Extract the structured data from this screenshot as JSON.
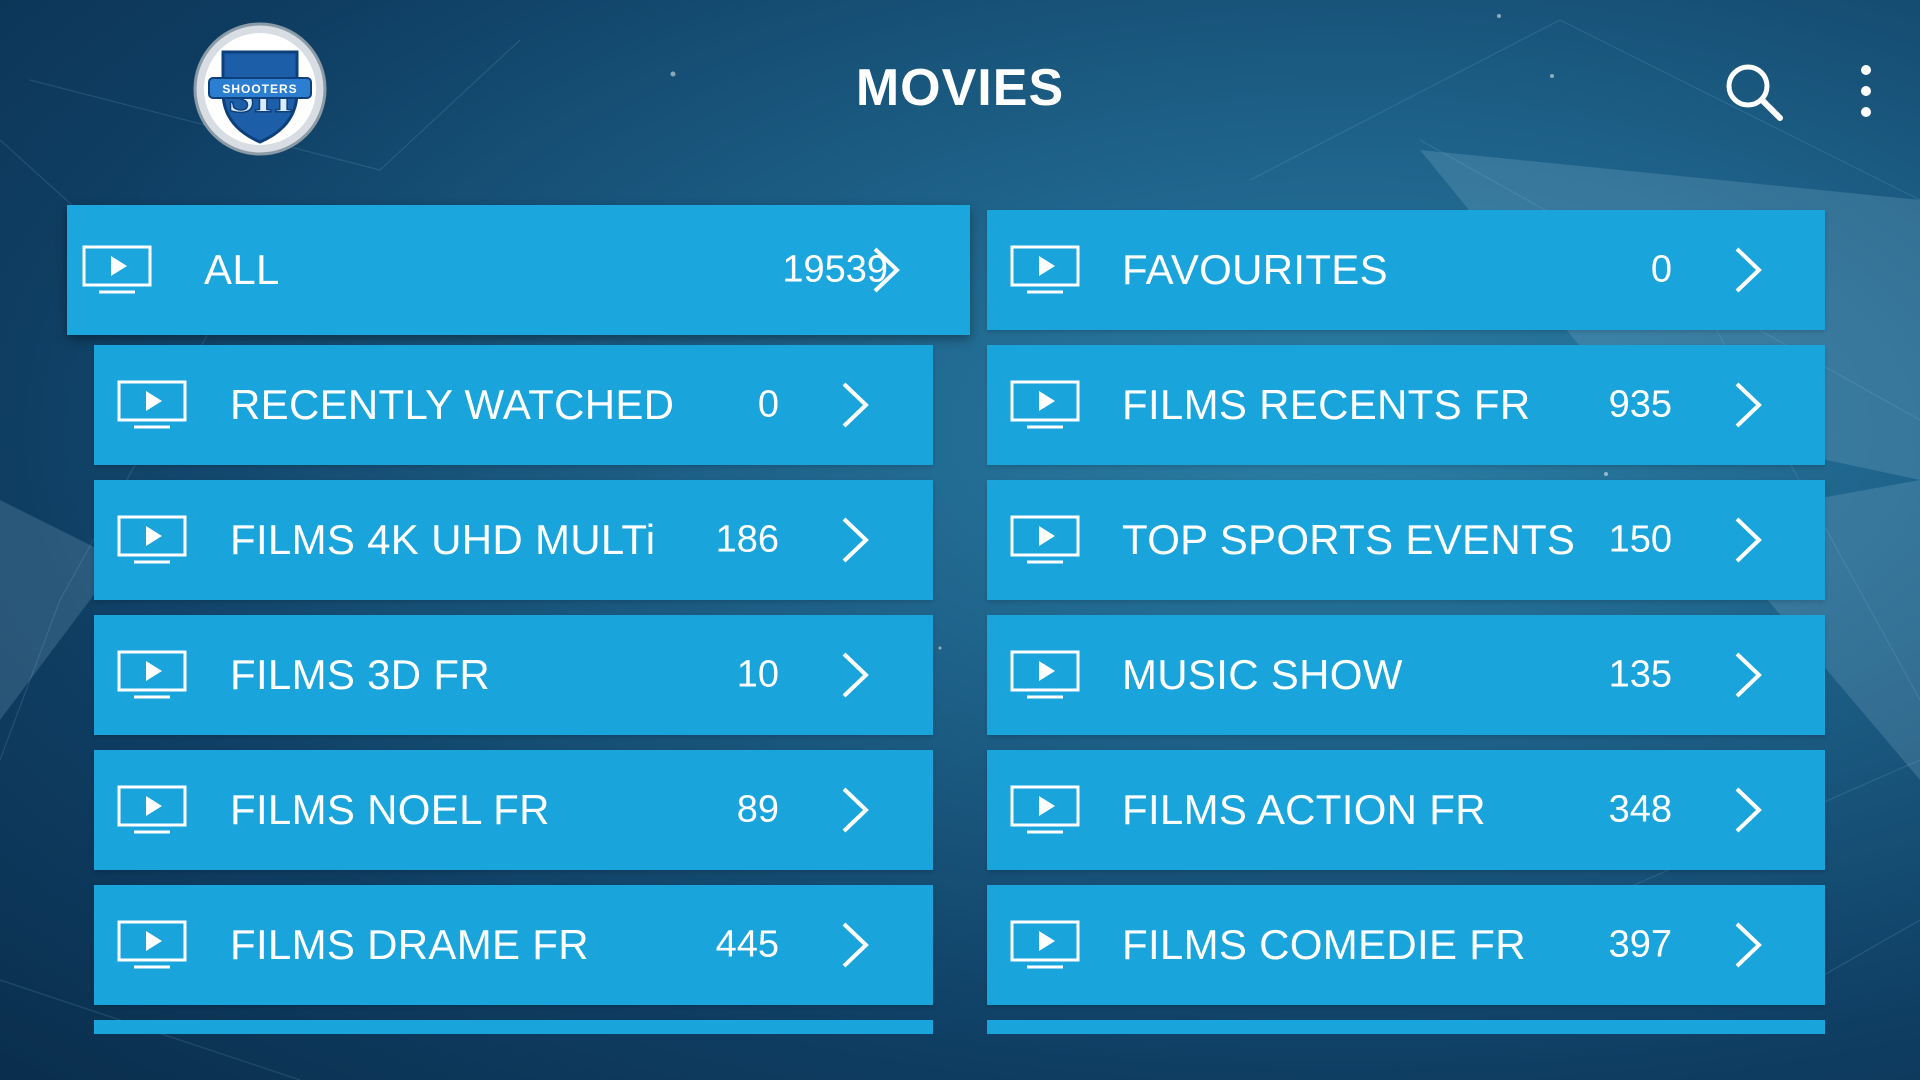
{
  "header": {
    "title": "MOVIES",
    "logo_text": "SHOOTERS",
    "logo_monogram": "SH",
    "search_icon": "search-icon",
    "menu_icon": "more-vert-icon"
  },
  "colors": {
    "tile": "#19a4dc",
    "background_dark": "#0a2e4d",
    "background_light": "#2b7fa6",
    "text": "#ffffff"
  },
  "categories": [
    {
      "label": "ALL",
      "count": "19539"
    },
    {
      "label": "FAVOURITES",
      "count": "0"
    },
    {
      "label": "RECENTLY WATCHED",
      "count": "0"
    },
    {
      "label": "FILMS RECENTS FR",
      "count": "935"
    },
    {
      "label": "FILMS 4K UHD MULTi",
      "count": "186"
    },
    {
      "label": "TOP SPORTS EVENTS",
      "count": "150"
    },
    {
      "label": "FILMS 3D FR",
      "count": "10"
    },
    {
      "label": "MUSIC SHOW",
      "count": "135"
    },
    {
      "label": "FILMS NOEL FR",
      "count": "89"
    },
    {
      "label": "FILMS ACTION FR",
      "count": "348"
    },
    {
      "label": "FILMS DRAME FR",
      "count": "445"
    },
    {
      "label": "FILMS COMEDIE FR",
      "count": "397"
    }
  ]
}
